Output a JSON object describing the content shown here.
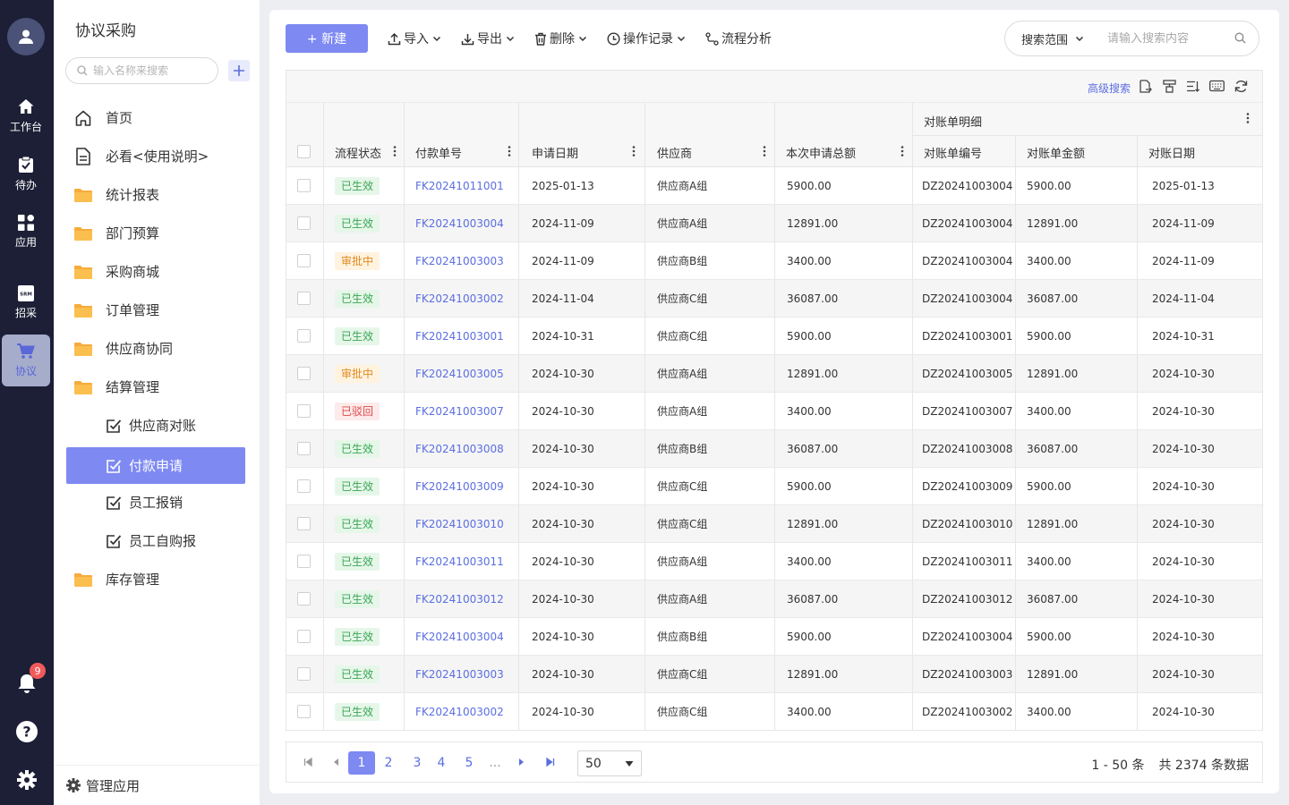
{
  "rail": {
    "items": [
      {
        "label": "工作台",
        "icon": "home-icon"
      },
      {
        "label": "待办",
        "icon": "clipboard-icon"
      },
      {
        "label": "应用",
        "icon": "apps-icon"
      },
      {
        "label": "招采",
        "icon": "srm-icon",
        "icon_text": "SRM"
      },
      {
        "label": "协议",
        "icon": "cart-icon"
      }
    ],
    "active": "协议",
    "notification_count": "9"
  },
  "nav": {
    "title": "协议采购",
    "search_placeholder": "输入名称来搜索",
    "items": [
      {
        "label": "首页",
        "icon": "home-outline-icon"
      },
      {
        "label": "必看<使用说明>",
        "icon": "document-icon"
      },
      {
        "label": "统计报表",
        "icon": "folder-icon"
      },
      {
        "label": "部门预算",
        "icon": "folder-icon"
      },
      {
        "label": "采购商城",
        "icon": "folder-icon"
      },
      {
        "label": "订单管理",
        "icon": "folder-icon"
      },
      {
        "label": "供应商协同",
        "icon": "folder-icon"
      },
      {
        "label": "结算管理",
        "icon": "folder-icon"
      },
      {
        "label": "供应商对账",
        "icon": "checkbox-edit-icon"
      },
      {
        "label": "付款申请",
        "icon": "checkbox-edit-icon"
      },
      {
        "label": "员工报销",
        "icon": "checkbox-edit-icon"
      },
      {
        "label": "员工自购报",
        "icon": "checkbox-edit-icon"
      },
      {
        "label": "库存管理",
        "icon": "folder-icon"
      }
    ],
    "active": "付款申请",
    "footer_label": "管理应用"
  },
  "toolbar": {
    "new_label": "+ 新建",
    "import_label": "导入",
    "export_label": "导出",
    "delete_label": "删除",
    "log_label": "操作记录",
    "flow_label": "流程分析",
    "scope_label": "搜索范围",
    "search_placeholder": "请输入搜索内容"
  },
  "grid": {
    "advanced_search": "高级搜索",
    "group_header": "对账单明细",
    "columns": [
      "流程状态",
      "付款单号",
      "申请日期",
      "供应商",
      "本次申请总额",
      "对账单编号",
      "对账单金额",
      "对账日期"
    ],
    "rows": [
      {
        "status": "已生效",
        "type": "ok",
        "no": "FK20241011001",
        "date": "2025-01-13",
        "vendor": "供应商A组",
        "amount": "5900.00",
        "bill_no": "DZ20241003004",
        "bill_amount": "5900.00",
        "bill_date": "2025-01-13"
      },
      {
        "status": "已生效",
        "type": "ok",
        "no": "FK20241003004",
        "date": "2024-11-09",
        "vendor": "供应商A组",
        "amount": "12891.00",
        "bill_no": "DZ20241003004",
        "bill_amount": "12891.00",
        "bill_date": "2024-11-09"
      },
      {
        "status": "审批中",
        "type": "wait",
        "no": "FK20241003003",
        "date": "2024-11-09",
        "vendor": "供应商B组",
        "amount": "3400.00",
        "bill_no": "DZ20241003004",
        "bill_amount": "3400.00",
        "bill_date": "2024-11-09"
      },
      {
        "status": "已生效",
        "type": "ok",
        "no": "FK20241003002",
        "date": "2024-11-04",
        "vendor": "供应商C组",
        "amount": "36087.00",
        "bill_no": "DZ20241003004",
        "bill_amount": "36087.00",
        "bill_date": "2024-11-04"
      },
      {
        "status": "已生效",
        "type": "ok",
        "no": "FK20241003001",
        "date": "2024-10-31",
        "vendor": "供应商C组",
        "amount": "5900.00",
        "bill_no": "DZ20241003001",
        "bill_amount": "5900.00",
        "bill_date": "2024-10-31"
      },
      {
        "status": "审批中",
        "type": "wait",
        "no": "FK20241003005",
        "date": "2024-10-30",
        "vendor": "供应商A组",
        "amount": "12891.00",
        "bill_no": "DZ20241003005",
        "bill_amount": "12891.00",
        "bill_date": "2024-10-30"
      },
      {
        "status": "已驳回",
        "type": "rej",
        "no": "FK20241003007",
        "date": "2024-10-30",
        "vendor": "供应商A组",
        "amount": "3400.00",
        "bill_no": "DZ20241003007",
        "bill_amount": "3400.00",
        "bill_date": "2024-10-30"
      },
      {
        "status": "已生效",
        "type": "ok",
        "no": "FK20241003008",
        "date": "2024-10-30",
        "vendor": "供应商B组",
        "amount": "36087.00",
        "bill_no": "DZ20241003008",
        "bill_amount": "36087.00",
        "bill_date": "2024-10-30"
      },
      {
        "status": "已生效",
        "type": "ok",
        "no": "FK20241003009",
        "date": "2024-10-30",
        "vendor": "供应商C组",
        "amount": "5900.00",
        "bill_no": "DZ20241003009",
        "bill_amount": "5900.00",
        "bill_date": "2024-10-30"
      },
      {
        "status": "已生效",
        "type": "ok",
        "no": "FK20241003010",
        "date": "2024-10-30",
        "vendor": "供应商C组",
        "amount": "12891.00",
        "bill_no": "DZ20241003010",
        "bill_amount": "12891.00",
        "bill_date": "2024-10-30"
      },
      {
        "status": "已生效",
        "type": "ok",
        "no": "FK20241003011",
        "date": "2024-10-30",
        "vendor": "供应商A组",
        "amount": "3400.00",
        "bill_no": "DZ20241003011",
        "bill_amount": "3400.00",
        "bill_date": "2024-10-30"
      },
      {
        "status": "已生效",
        "type": "ok",
        "no": "FK20241003012",
        "date": "2024-10-30",
        "vendor": "供应商A组",
        "amount": "36087.00",
        "bill_no": "DZ20241003012",
        "bill_amount": "36087.00",
        "bill_date": "2024-10-30"
      },
      {
        "status": "已生效",
        "type": "ok",
        "no": "FK20241003004",
        "date": "2024-10-30",
        "vendor": "供应商B组",
        "amount": "5900.00",
        "bill_no": "DZ20241003004",
        "bill_amount": "5900.00",
        "bill_date": "2024-10-30"
      },
      {
        "status": "已生效",
        "type": "ok",
        "no": "FK20241003003",
        "date": "2024-10-30",
        "vendor": "供应商C组",
        "amount": "12891.00",
        "bill_no": "DZ20241003003",
        "bill_amount": "12891.00",
        "bill_date": "2024-10-30"
      },
      {
        "status": "已生效",
        "type": "ok",
        "no": "FK20241003002",
        "date": "2024-10-30",
        "vendor": "供应商C组",
        "amount": "3400.00",
        "bill_no": "DZ20241003002",
        "bill_amount": "3400.00",
        "bill_date": "2024-10-30"
      }
    ]
  },
  "pager": {
    "pages": [
      "1",
      "2",
      "3",
      "4",
      "5",
      "..."
    ],
    "current": "1",
    "page_size": "50",
    "range": "1 - 50 条",
    "total": "共 2374 条数据"
  },
  "colors": {
    "accent": "#7e89f2",
    "link": "#5b6ee1",
    "rail_bg": "#1c1f36",
    "ok": "#3aa655",
    "wait": "#e08a1e",
    "rej": "#e04848"
  }
}
